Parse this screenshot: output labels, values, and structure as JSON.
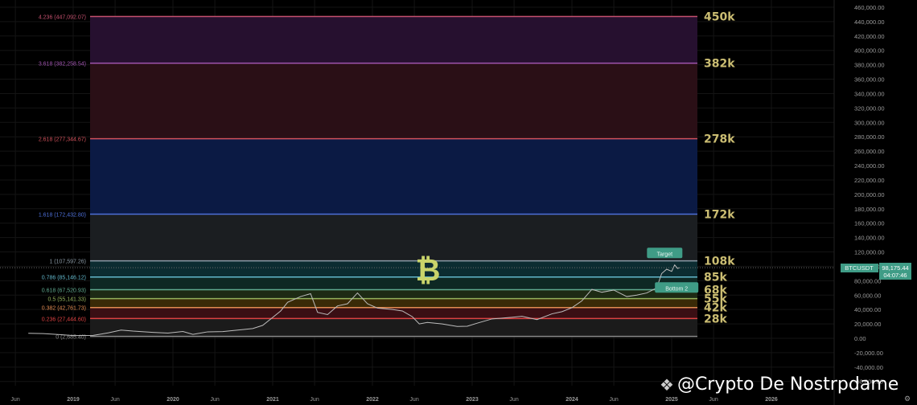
{
  "chart_data": {
    "type": "line",
    "title": "",
    "symbol": "BTCUSDT",
    "current_price": "98,175.44",
    "countdown": "04:07:46",
    "ylim": [
      -60000,
      460000
    ],
    "xlim": [
      2018.55,
      2026.3
    ],
    "y_ticks": [
      "460,000.00",
      "440,000.00",
      "420,000.00",
      "400,000.00",
      "380,000.00",
      "360,000.00",
      "340,000.00",
      "320,000.00",
      "300,000.00",
      "280,000.00",
      "260,000.00",
      "240,000.00",
      "220,000.00",
      "200,000.00",
      "180,000.00",
      "160,000.00",
      "140,000.00",
      "120,000.00",
      "100,000.00",
      "80,000.00",
      "60,000.00",
      "40,000.00",
      "20,000.00",
      "0.00",
      "-20,000.00",
      "-40,000.00",
      "-60,000.00"
    ],
    "x_ticks": [
      {
        "label": "Jun",
        "t": 2018.42
      },
      {
        "label": "2019",
        "t": 2019
      },
      {
        "label": "Jun",
        "t": 2019.42
      },
      {
        "label": "2020",
        "t": 2020
      },
      {
        "label": "Jun",
        "t": 2020.42
      },
      {
        "label": "2021",
        "t": 2021
      },
      {
        "label": "Jun",
        "t": 2021.42
      },
      {
        "label": "2022",
        "t": 2022
      },
      {
        "label": "Jun",
        "t": 2022.42
      },
      {
        "label": "2023",
        "t": 2023
      },
      {
        "label": "Jun",
        "t": 2023.42
      },
      {
        "label": "2024",
        "t": 2024
      },
      {
        "label": "Jun",
        "t": 2024.42
      },
      {
        "label": "2025",
        "t": 2025
      },
      {
        "label": "Jun",
        "t": 2025.42
      },
      {
        "label": "2026",
        "t": 2026
      }
    ],
    "fib_range": [
      2017.95,
      2026.05
    ],
    "fib_levels": [
      {
        "label": "4.236 (447,092.07)",
        "price": 447092.07,
        "tag": "450k",
        "line": "#c4506e",
        "fill": "#26102f"
      },
      {
        "label": "3.618 (382,258.54)",
        "price": 382258.54,
        "tag": "382k",
        "line": "#a054b0",
        "fill": "#2a0f16"
      },
      {
        "label": "2.618 (277,344.67)",
        "price": 277344.67,
        "tag": "278k",
        "line": "#d0505a",
        "fill": "#0b1a44"
      },
      {
        "label": "1.618 (172,432.80)",
        "price": 172432.8,
        "tag": "172k",
        "line": "#4d6fd8",
        "fill": "#1b1e21"
      },
      {
        "label": "1 (107,597.26)",
        "price": 107597.26,
        "tag": "108k",
        "line": "#8b9aa6",
        "fill": "#0c2c31"
      },
      {
        "label": "0.786 (85,146.12)",
        "price": 85146.12,
        "tag": "85k",
        "line": "#62b8cc",
        "fill": "#0e2824"
      },
      {
        "label": "0.618 (67,520.93)",
        "price": 67520.93,
        "tag": "68k",
        "line": "#60aa90",
        "fill": "#1d2a14"
      },
      {
        "label": "0.5 (55,141.33)",
        "price": 55141.33,
        "tag": "55k",
        "line": "#94b25c",
        "fill": "#3a2a07"
      },
      {
        "label": "0.382 (42,761.73)",
        "price": 42761.73,
        "tag": "42k",
        "line": "#e38c52",
        "fill": "#3a0f14"
      },
      {
        "label": "0.236 (27,444.60)",
        "price": 27444.6,
        "tag": "28k",
        "line": "#dc4242",
        "fill": "#1b1b1b"
      },
      {
        "label": "0 (2,685.40)",
        "price": 2685.4,
        "tag": "",
        "line": "#8a8a8a",
        "fill": ""
      }
    ],
    "series": [
      {
        "name": "BTCUSDT",
        "x": [
          2018.55,
          2018.7,
          2018.88,
          2019.0,
          2019.2,
          2019.35,
          2019.48,
          2019.6,
          2019.8,
          2019.95,
          2020.1,
          2020.2,
          2020.35,
          2020.5,
          2020.65,
          2020.8,
          2020.9,
          2021.0,
          2021.08,
          2021.15,
          2021.28,
          2021.38,
          2021.45,
          2021.55,
          2021.65,
          2021.75,
          2021.85,
          2021.95,
          2022.05,
          2022.2,
          2022.3,
          2022.4,
          2022.47,
          2022.55,
          2022.7,
          2022.85,
          2022.95,
          2023.05,
          2023.2,
          2023.3,
          2023.5,
          2023.65,
          2023.8,
          2023.9,
          2024.0,
          2024.1,
          2024.2,
          2024.3,
          2024.42,
          2024.55,
          2024.65,
          2024.75,
          2024.85,
          2024.9,
          2024.95,
          2025.0,
          2025.03,
          2025.06,
          2025.08
        ],
        "y": [
          7000,
          6500,
          5000,
          3700,
          4000,
          7500,
          11500,
          10000,
          8200,
          7200,
          9500,
          5500,
          9000,
          9300,
          11500,
          13500,
          18000,
          29000,
          38000,
          50000,
          58000,
          62000,
          36000,
          33000,
          45000,
          48000,
          63000,
          48000,
          42000,
          40000,
          38000,
          30000,
          20000,
          22000,
          20000,
          16500,
          16800,
          21000,
          27000,
          28000,
          30500,
          26000,
          34000,
          37000,
          42500,
          52000,
          68000,
          64000,
          67000,
          58000,
          60000,
          63000,
          70000,
          90000,
          96000,
          93000,
          102000,
          97000,
          98175
        ]
      },
      {
        "name": "current-price-line",
        "price": 98175.44
      }
    ],
    "annotations": [
      {
        "text": "Target",
        "t": 2024.93,
        "price": 118000
      },
      {
        "text": "Bottom 2",
        "t": 2025.05,
        "price": 70000
      }
    ],
    "logo_text": "₿"
  },
  "watermark": "@Crypto De Nostrpdame"
}
